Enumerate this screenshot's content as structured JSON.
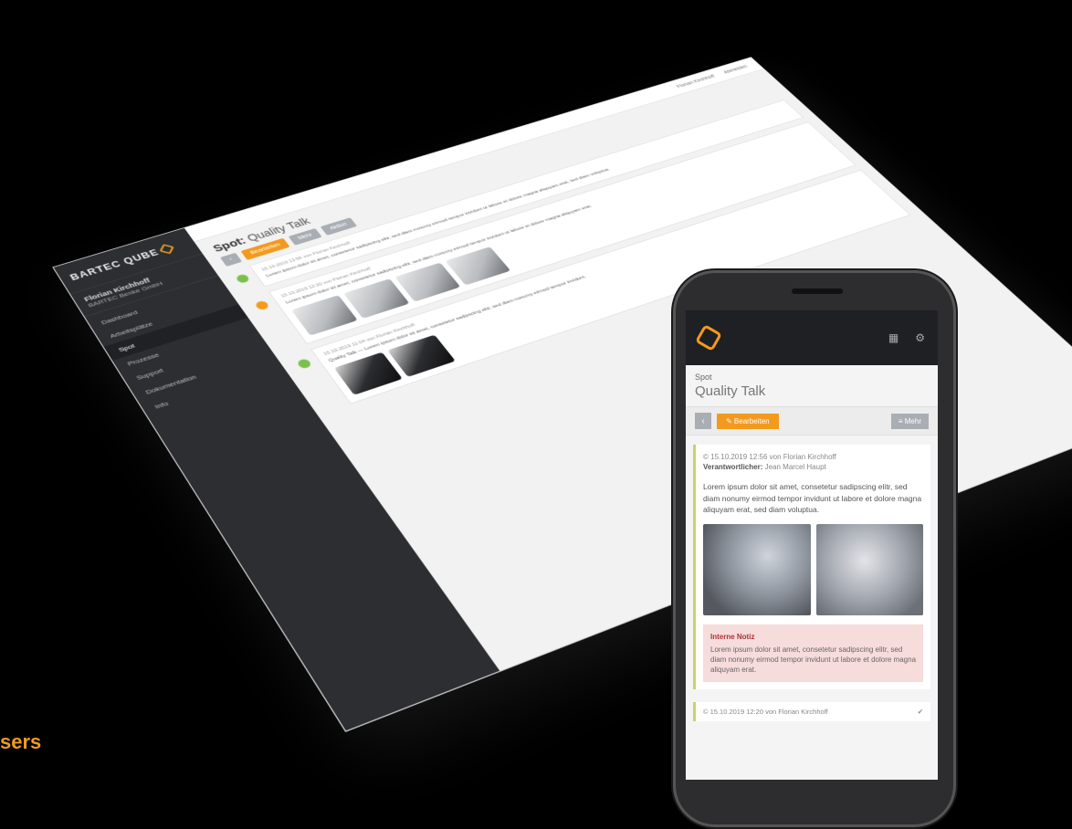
{
  "caption": "sers",
  "desktop": {
    "logo": "BARTEC QUBE",
    "user": {
      "name": "Florian Kirchhoff",
      "sub": "BARTEC Benke GmbH"
    },
    "nav": [
      "Dashboard",
      "Arbeitsplätze",
      "Spot",
      "Prozesse",
      "Support",
      "Dokumentation",
      "Info"
    ],
    "topbar": [
      "Florian Kirchhoff",
      "Abmelden"
    ],
    "title_prefix": "Spot:",
    "title": "Quality Talk",
    "buttons": {
      "back": "‹",
      "edit": "Bearbeiten",
      "a": "Mehr",
      "b": "Aktion"
    },
    "cards": [
      {
        "meta": "15.10.2019 13:56 von Florian Kirchhoff",
        "text": "Lorem ipsum dolor sit amet, consetetur sadipscing elitr, sed diam nonumy eirmod tempor invidunt ut labore et dolore magna aliquyam erat, sed diam voluptua."
      },
      {
        "meta": "15.10.2019 12:20 von Florian Kirchhoff",
        "text": "Lorem ipsum dolor sit amet, consetetur sadipscing elitr, sed diam nonumy eirmod tempor invidunt ut labore et dolore magna aliquyam erat."
      },
      {
        "meta": "15.10.2019 11:04 von Florian Kirchhoff",
        "text": "Quality Talk — Lorem ipsum dolor sit amet, consetetur sadipscing elitr, sed diam nonumy eirmod tempor invidunt."
      }
    ]
  },
  "phone": {
    "crumb": "Spot",
    "title": "Quality Talk",
    "back": "‹",
    "edit": "✎ Bearbeiten",
    "more": "≡ Mehr",
    "card": {
      "meta": "© 15.10.2019 12:56 von Florian Kirchhoff",
      "resp_label": "Verantwortlicher:",
      "resp_value": "Jean Marcel Haupt",
      "text": "Lorem ipsum dolor sit amet, consetetur sadipscing elitr, sed diam nonumy eirmod tempor invidunt ut labore et dolore magna aliquyam erat, sed diam voluptua.",
      "note_title": "Interne Notiz",
      "note_text": "Lorem ipsum dolor sit amet, consetetur sadipscing elitr, sed diam nonumy eirmod tempor invidunt ut labore et dolore magna aliquyam erat."
    },
    "card2": {
      "meta": "© 15.10.2019 12:20 von Florian Kirchhoff",
      "check": "✔"
    }
  }
}
